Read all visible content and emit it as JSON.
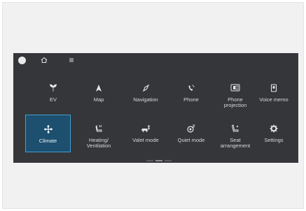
{
  "topbar": {
    "icons": [
      "status-dot",
      "home-icon",
      "menu-icon"
    ]
  },
  "tiles": [
    {
      "label": "EV",
      "icon": "leaf-icon"
    },
    {
      "label": "Map",
      "icon": "map-arrow-icon"
    },
    {
      "label": "Navigation",
      "icon": "compass-icon"
    },
    {
      "label": "Phone",
      "icon": "phone-icon"
    },
    {
      "label": "Phone\nprojection",
      "icon": "phone-projection-icon"
    },
    {
      "label": "Voice memo",
      "icon": "voice-memo-icon"
    },
    {
      "label": "Climate",
      "icon": "fan-icon",
      "selected": true
    },
    {
      "label": "Heating/\nVentilation",
      "icon": "seat-heating-icon"
    },
    {
      "label": "Valet mode",
      "icon": "valet-icon"
    },
    {
      "label": "Quiet mode",
      "icon": "quiet-mode-icon"
    },
    {
      "label": "Seat\narrangement",
      "icon": "seat-arrangement-icon"
    },
    {
      "label": "Settings",
      "icon": "gear-icon"
    }
  ],
  "colors": {
    "screen_bg": "#35363a",
    "selected_bg": "#1d4f6e",
    "selected_border": "#3ea0d3",
    "icon": "#e6e6e6"
  }
}
